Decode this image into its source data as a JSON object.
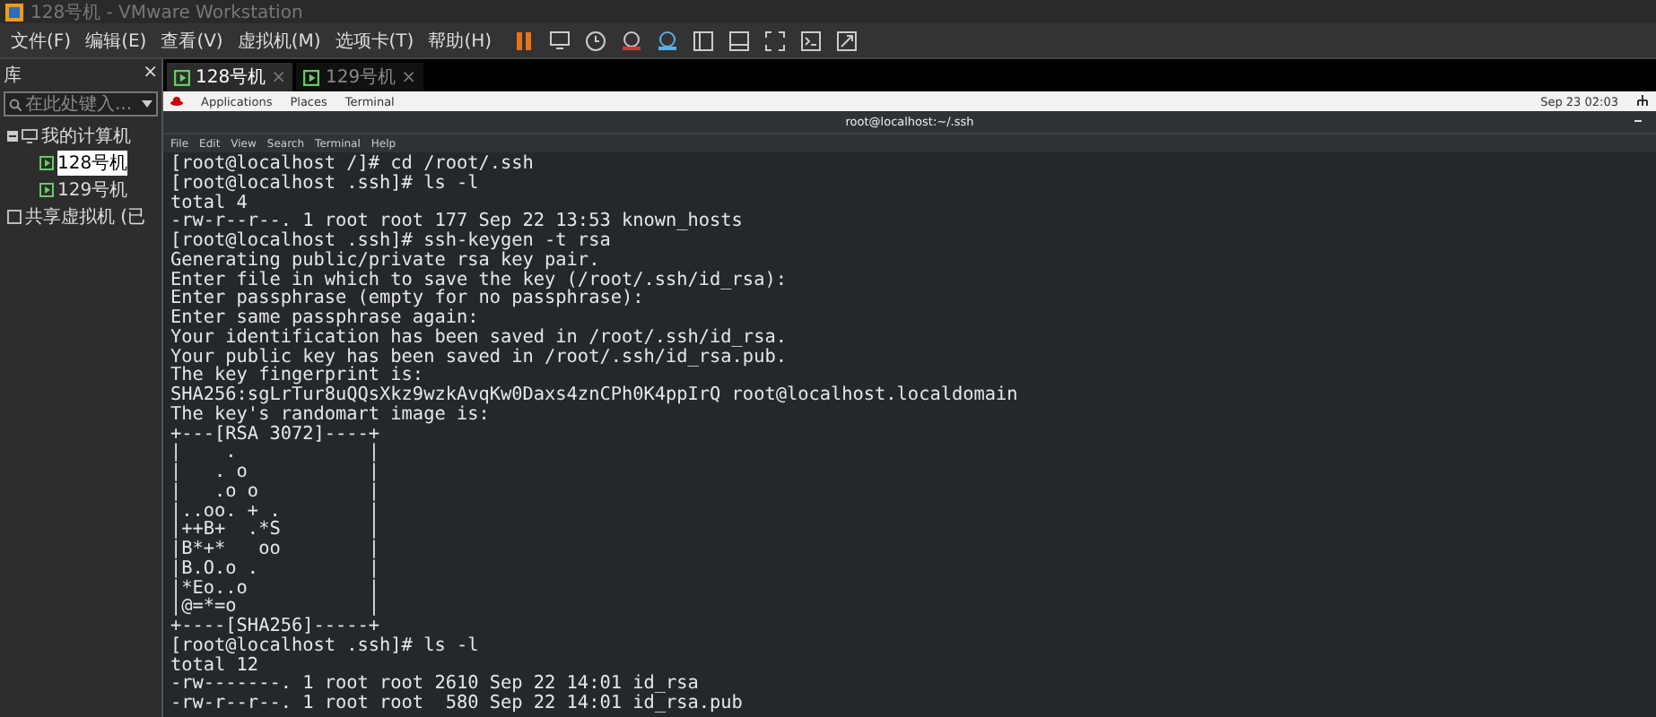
{
  "window": {
    "title": "128号机 - VMware Workstation"
  },
  "menu": [
    "文件(F)",
    "编辑(E)",
    "查看(V)",
    "虚拟机(M)",
    "选项卡(T)",
    "帮助(H)"
  ],
  "library": {
    "title": "库",
    "close": "×",
    "search": {
      "placeholder": "在此处键入..."
    },
    "tree": [
      {
        "label": "我的计算机",
        "kind": "computer",
        "expanded": true,
        "selected": false,
        "children": [
          {
            "label": "128号机",
            "kind": "vm",
            "selected": true
          },
          {
            "label": "129号机",
            "kind": "vm",
            "selected": false
          }
        ]
      },
      {
        "label": "共享虚拟机 (已",
        "kind": "shared",
        "selected": false
      }
    ]
  },
  "tabs": [
    {
      "label": "128号机",
      "selected": true,
      "close": "×"
    },
    {
      "label": "129号机",
      "selected": false,
      "close": "×"
    }
  ],
  "guest": {
    "topbar": {
      "items": [
        "Applications",
        "Places",
        "Terminal"
      ],
      "clock": "Sep 23  02:03"
    },
    "terminal": {
      "title": "root@localhost:~/.ssh",
      "menu": [
        "File",
        "Edit",
        "View",
        "Search",
        "Terminal",
        "Help"
      ],
      "lines": [
        "[root@localhost /]# cd /root/.ssh",
        "[root@localhost .ssh]# ls -l",
        "total 4",
        "-rw-r--r--. 1 root root 177 Sep 22 13:53 known_hosts",
        "[root@localhost .ssh]# ssh-keygen -t rsa",
        "Generating public/private rsa key pair.",
        "Enter file in which to save the key (/root/.ssh/id_rsa):",
        "Enter passphrase (empty for no passphrase):",
        "Enter same passphrase again:",
        "Your identification has been saved in /root/.ssh/id_rsa.",
        "Your public key has been saved in /root/.ssh/id_rsa.pub.",
        "The key fingerprint is:",
        "SHA256:sgLrTur8uQQsXkz9wzkAvqKw0Daxs4znCPh0K4ppIrQ root@localhost.localdomain",
        "The key's randomart image is:",
        "+---[RSA 3072]----+",
        "|    .            |",
        "|   . o           |",
        "|   .o o          |",
        "|..oo. + .        |",
        "|++B+  .*S        |",
        "|B*+*   oo        |",
        "|B.O.o .          |",
        "|*Eo..o           |",
        "|@=*=o            |",
        "+----[SHA256]-----+",
        "[root@localhost .ssh]# ls -l",
        "total 12",
        "-rw-------. 1 root root 2610 Sep 22 14:01 id_rsa",
        "-rw-r--r--. 1 root root  580 Sep 22 14:01 id_rsa.pub"
      ]
    }
  }
}
